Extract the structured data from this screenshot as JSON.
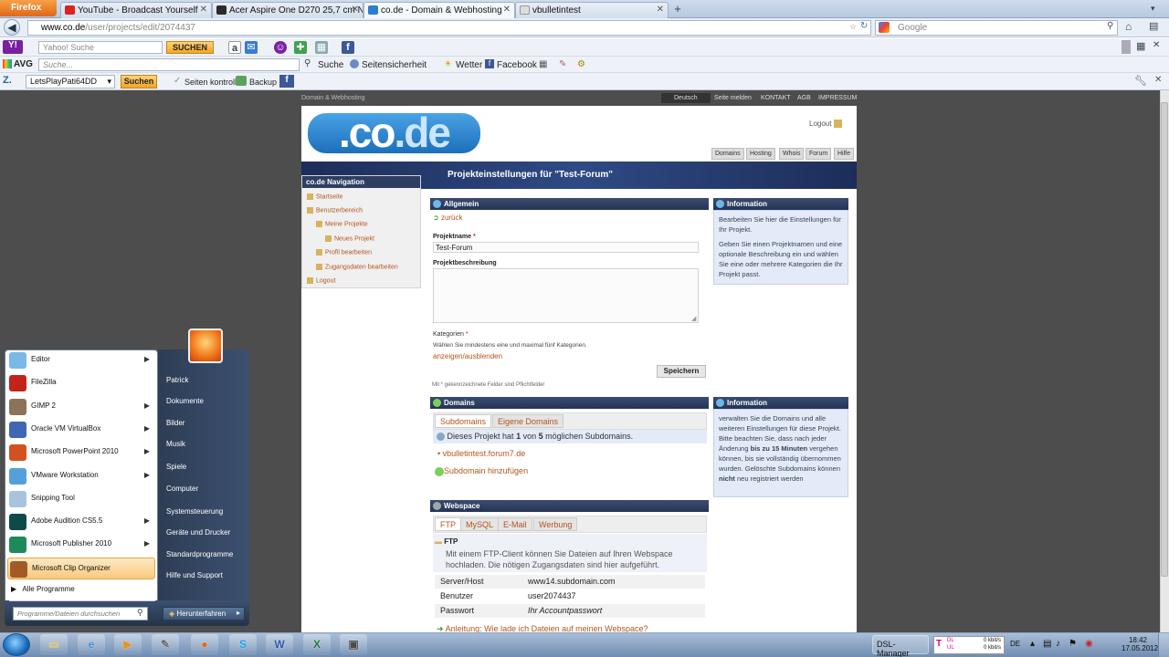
{
  "browser": {
    "app_button": "Firefox",
    "tabs": [
      {
        "label": "YouTube - Broadcast Yourself",
        "color": "#e02020"
      },
      {
        "label": "Acer Aspire One D270 25,7 cm Netbo...",
        "color": "#2a2a2a"
      },
      {
        "label": "co.de - Domain & Webhosting",
        "color": "#2b7dd0"
      },
      {
        "label": "vbulletintest",
        "color": "#dddddd"
      }
    ],
    "url_host": "www.co.de",
    "url_path": "/user/projects/edit/2074437",
    "search_placeholder": "Google"
  },
  "toolbar1": {
    "yahoo_placeholder": "Yahoo! Suche",
    "yahoo_button": "SUCHEN"
  },
  "toolbar2": {
    "avg_label": "AVG",
    "search_placeholder": "Suche...",
    "items": [
      "Suche",
      "Seitensicherheit",
      "Wetter",
      "Facebook"
    ]
  },
  "toolbar3": {
    "combo_value": "LetsPlayPati64DD",
    "search_button": "Suchen",
    "items": [
      "Seiten kontrolle",
      "Backup"
    ]
  },
  "site": {
    "top_label": "Domain & Webhosting",
    "top_links": [
      "Deutsch",
      "Seite melden",
      "KONTAKT",
      "AGB",
      "IMPRESSUM"
    ],
    "logo_a": ".co",
    "logo_b": ".de",
    "logout": "Logout",
    "subtabs": [
      "Domains",
      "Hosting",
      "Whois",
      "Forum",
      "Hilfe"
    ],
    "page_title": "Projekteinstellungen für \"Test-Forum\"",
    "nav": {
      "title": "co.de Navigation",
      "items": [
        "Startseite",
        "Benutzerbereich",
        "Meine Projekte",
        "Neues Projekt",
        "Profil bearbeiten",
        "Zugangsdaten bearbeiten",
        "Logout"
      ]
    },
    "allgemein": {
      "title": "Allgemein",
      "back": "zurück",
      "name_label": "Projektname",
      "name_value": "Test-Forum",
      "desc_label": "Projektbeschreibung",
      "cat_label": "Kategorien",
      "cat_hint": "Wählen Sie mindestens eine und maximal fünf Kategorien.",
      "toggle": "anzeigen/ausblenden",
      "save": "Speichern",
      "required_note": "Mit * gekennzeichnete Felder sind Pflichtfelder"
    },
    "info1": {
      "title": "Information",
      "p1": "Bearbeiten Sie hier die Einstellungen für Ihr Projekt.",
      "p2": "Geben Sie einen Projektnamen und eine optionale Beschreibung ein und wählen Sie eine oder mehrere Kategorien die Ihr Projekt passt."
    },
    "domains": {
      "title": "Domains",
      "tabs": [
        "Subdomains",
        "Eigene Domains"
      ],
      "note_a": "Dieses Projekt hat ",
      "note_n1": "1",
      "note_b": " von ",
      "note_n2": "5",
      "note_c": " möglichen Subdomains.",
      "item": "vbulletintest.forum7.de",
      "add": "Subdomain hinzufügen"
    },
    "info2": {
      "title": "Information",
      "t1": "verwalten Sie die Domains und alle weiteren Einstellungen für diese Projekt. Bitte beachten Sie, dass nach jeder Änderung ",
      "b1": "bis zu 15 Minuten",
      "t2": " vergehen können, bis sie vollständig übernommen wurden. Gelöschte Subdomains können ",
      "b2": "nicht",
      "t3": " neu registriert werden"
    },
    "webspace": {
      "title": "Webspace",
      "tabs": [
        "FTP",
        "MySQL",
        "E-Mail",
        "Werbung"
      ],
      "ftp_title": "FTP",
      "ftp_text": "Mit einem FTP-Client können Sie Dateien auf Ihren Webspace hochladen. Die nötigen Zugangsdaten sind hier aufgeführt.",
      "rows": [
        {
          "k": "Server/Host",
          "v": "www14.subdomain.com"
        },
        {
          "k": "Benutzer",
          "v": "user2074437"
        },
        {
          "k": "Passwort",
          "v": "Ihr Accountpasswort"
        }
      ],
      "guide": "Anleitung: Wie lade ich Dateien auf meinen Webspace?"
    }
  },
  "start_menu": {
    "programs": [
      {
        "label": "Editor",
        "arrow": true,
        "color": "#7ab8e6"
      },
      {
        "label": "FileZilla",
        "arrow": false,
        "color": "#c2241a"
      },
      {
        "label": "GIMP 2",
        "arrow": true,
        "color": "#8a7358"
      },
      {
        "label": "Oracle VM VirtualBox",
        "arrow": true,
        "color": "#3f67b3"
      },
      {
        "label": "Microsoft PowerPoint 2010",
        "arrow": true,
        "color": "#d2521f"
      },
      {
        "label": "VMware Workstation",
        "arrow": true,
        "color": "#55a0d8"
      },
      {
        "label": "Snipping Tool",
        "arrow": false,
        "color": "#a9c2de"
      },
      {
        "label": "Adobe Audition CS5.5",
        "arrow": true,
        "color": "#0f4a4a"
      },
      {
        "label": "Microsoft Publisher 2010",
        "arrow": true,
        "color": "#1f8a59"
      },
      {
        "label": "Microsoft Clip Organizer",
        "arrow": false,
        "color": "#a45a26"
      }
    ],
    "all_programs": "Alle Programme",
    "search_placeholder": "Programme/Dateien durchsuchen",
    "right_items": [
      "Patrick",
      "Dokumente",
      "Bilder",
      "Musik",
      "Spiele",
      "Computer",
      "Systemsteuerung",
      "Geräte und Drucker",
      "Standardprogramme",
      "Hilfe und Support"
    ],
    "shutdown": "Herunterfahren"
  },
  "taskbar": {
    "apps": [
      {
        "name": "explorer",
        "glyph": "▭",
        "color": "#e9c04b"
      },
      {
        "name": "internet-explorer",
        "glyph": "e",
        "color": "#2e8ed8"
      },
      {
        "name": "media-player",
        "glyph": "▶",
        "color": "#ef8f1f"
      },
      {
        "name": "tool",
        "glyph": "✎",
        "color": "#6a6a6a"
      },
      {
        "name": "firefox",
        "glyph": "●",
        "color": "#e46a16"
      },
      {
        "name": "skype",
        "glyph": "S",
        "color": "#14a3e6"
      },
      {
        "name": "word",
        "glyph": "W",
        "color": "#2a58a8"
      },
      {
        "name": "excel",
        "glyph": "X",
        "color": "#1e7a3e"
      },
      {
        "name": "archive",
        "glyph": "▣",
        "color": "#4a4a4a"
      }
    ],
    "dsl_manager": "DSL-Manager",
    "dl": "DL",
    "ul": "UL",
    "dl_rate": "0 kbit/s",
    "ul_rate": "0 kbit/s",
    "lang": "DE",
    "time": "18:42",
    "date": "17.05.2012"
  }
}
